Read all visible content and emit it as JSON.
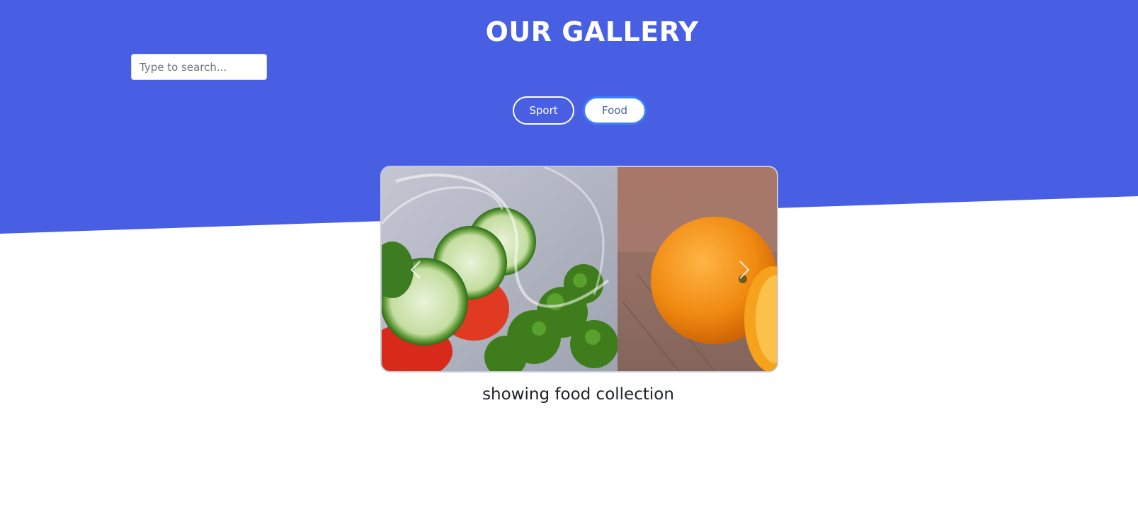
{
  "header": {
    "title": "OUR GALLERY",
    "background_color": "#485ee3"
  },
  "search": {
    "placeholder": "Type to search...",
    "value": ""
  },
  "filters": [
    {
      "label": "Sport",
      "active": false
    },
    {
      "label": "Food",
      "active": true
    }
  ],
  "carousel": {
    "slides": [
      "salad-photo",
      "orange-photo"
    ],
    "prev_icon": "chevron-left-icon",
    "next_icon": "chevron-right-icon"
  },
  "caption": "showing food collection",
  "colors": {
    "accent": "#485ee3",
    "active_border": "#3b82f6"
  }
}
